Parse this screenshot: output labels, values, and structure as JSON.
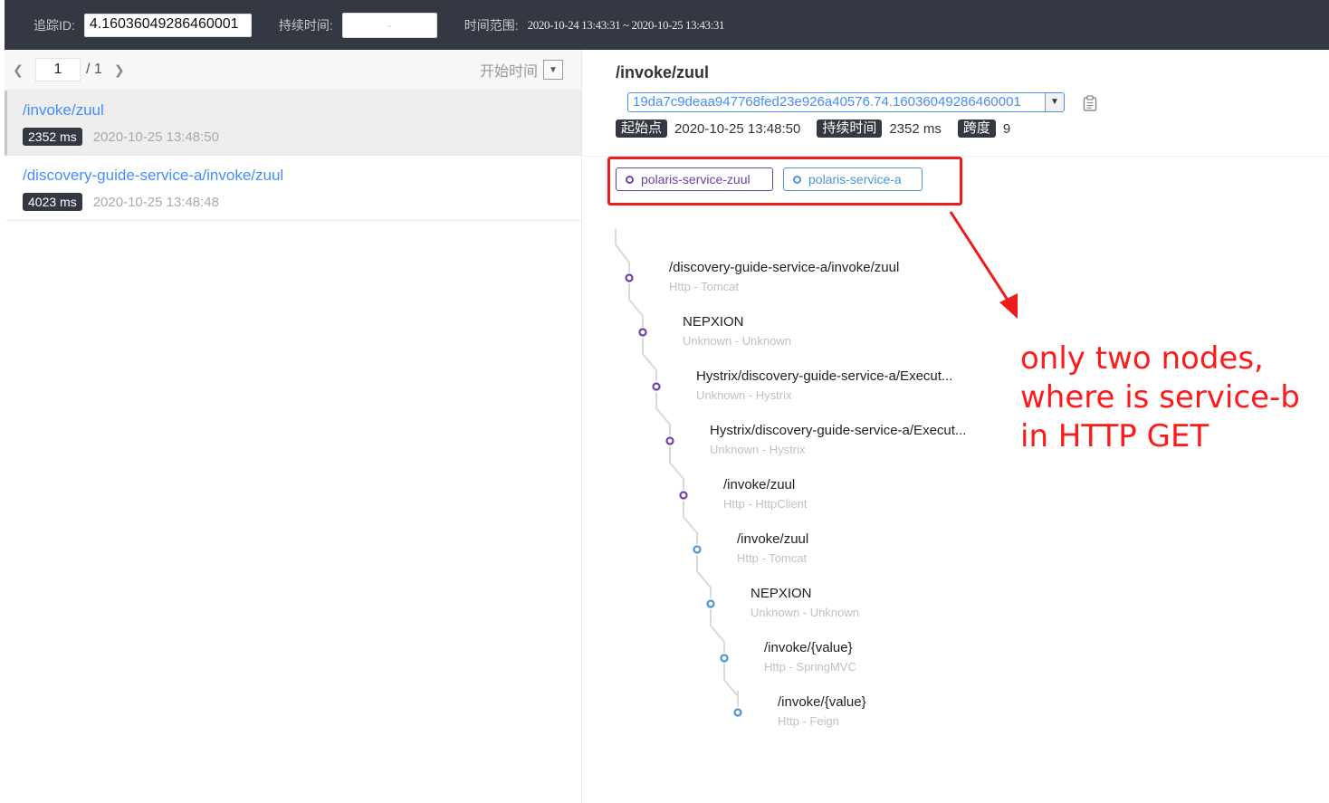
{
  "toolbar": {
    "trace_id_label": "追踪ID:",
    "trace_id_value": "4.16036049286460001",
    "duration_label": "持续时间:",
    "duration_placeholder": "-",
    "time_range_label": "时间范围:",
    "time_range_value": "2020-10-24 13:43:31 ~ 2020-10-25 13:43:31"
  },
  "pager": {
    "current_page": "1",
    "total_pages": "/ 1",
    "sort_label": "开始时间"
  },
  "trace_list": [
    {
      "endpoint": "/invoke/zuul",
      "duration": "2352 ms",
      "start_time": "2020-10-25 13:48:50",
      "selected": true
    },
    {
      "endpoint": "/discovery-guide-service-a/invoke/zuul",
      "duration": "4023 ms",
      "start_time": "2020-10-25 13:48:48",
      "selected": false
    }
  ],
  "detail": {
    "title": "/invoke/zuul",
    "trace_id": "19da7c9deaa947768fed23e926a40576.74.16036049286460001",
    "start_label": "起始点",
    "start_value": "2020-10-25 13:48:50",
    "duration_label": "持续时间",
    "duration_value": "2352 ms",
    "span_label": "跨度",
    "span_value": "9"
  },
  "services": [
    {
      "name": "polaris-service-zuul",
      "color": "#6e40aa"
    },
    {
      "name": "polaris-service-a",
      "color": "#4c94db"
    }
  ],
  "spans": [
    {
      "name": "/discovery-guide-service-a/invoke/zuul",
      "type": "Http - Tomcat",
      "service": 0
    },
    {
      "name": "NEPXION",
      "type": "Unknown - Unknown",
      "service": 0
    },
    {
      "name": "Hystrix/discovery-guide-service-a/Execut...",
      "type": "Unknown - Hystrix",
      "service": 0
    },
    {
      "name": "Hystrix/discovery-guide-service-a/Execut...",
      "type": "Unknown - Hystrix",
      "service": 0
    },
    {
      "name": "/invoke/zuul",
      "type": "Http - HttpClient",
      "service": 0
    },
    {
      "name": "/invoke/zuul",
      "type": "Http - Tomcat",
      "service": 1
    },
    {
      "name": "NEPXION",
      "type": "Unknown - Unknown",
      "service": 1
    },
    {
      "name": "/invoke/{value}",
      "type": "Http - SpringMVC",
      "service": 1
    },
    {
      "name": "/invoke/{value}",
      "type": "Http - Feign",
      "service": 1
    }
  ],
  "annotation": {
    "line1": "only two nodes,",
    "line2": "where is service-b",
    "line3": "in HTTP GET",
    "color": "#ff1a1a"
  },
  "colors": {
    "toolbar_bg": "#333843",
    "link": "#448dfe",
    "badge_bg": "#333843",
    "highlight": "#ee1c1c"
  }
}
